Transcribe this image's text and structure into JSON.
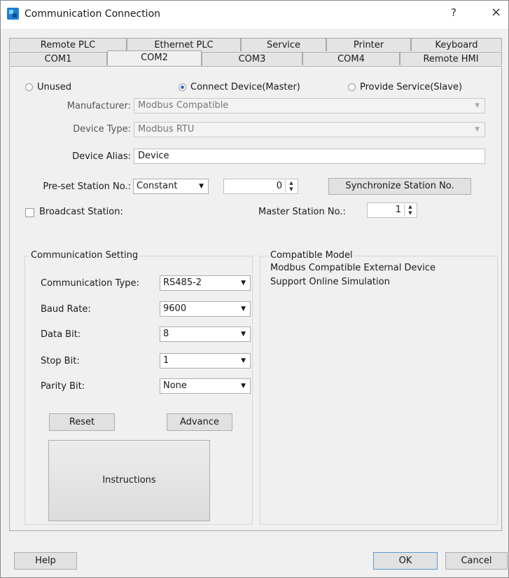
{
  "window": {
    "title": "Communication Connection",
    "help_glyph": "?",
    "close_glyph": "×"
  },
  "tabs_top": [
    "Remote PLC",
    "Ethernet PLC",
    "Service",
    "Printer",
    "Keyboard"
  ],
  "tabs_bottom": [
    "COM1",
    "COM2",
    "COM3",
    "COM4",
    "Remote HMI"
  ],
  "active_tab": "COM2",
  "mode": {
    "unused": "Unused",
    "master": "Connect Device(Master)",
    "slave": "Provide Service(Slave)",
    "selected": "master"
  },
  "manufacturer": {
    "label": "Manufacturer:",
    "value": "Modbus Compatible"
  },
  "device_type": {
    "label": "Device Type:",
    "value": "Modbus RTU"
  },
  "device_alias": {
    "label": "Device Alias:",
    "value": "Device"
  },
  "preset_station": {
    "label": "Pre-set Station No.:",
    "value": "Constant",
    "number": "0"
  },
  "sync_button": "Synchronize Station No.",
  "broadcast": {
    "label": "Broadcast Station:",
    "checked": false
  },
  "master_station": {
    "label": "Master Station No.:",
    "value": "1"
  },
  "comm": {
    "title": "Communication Setting",
    "type": {
      "label": "Communication Type:",
      "value": "RS485-2"
    },
    "baud": {
      "label": "Baud Rate:",
      "value": "9600"
    },
    "data_bit": {
      "label": "Data Bit:",
      "value": "8"
    },
    "stop_bit": {
      "label": "Stop Bit:",
      "value": "1"
    },
    "parity": {
      "label": "Parity Bit:",
      "value": "None"
    },
    "reset": "Reset",
    "advance": "Advance",
    "instructions": "Instructions"
  },
  "compat": {
    "title": "Compatible Model",
    "line1": "Modbus Compatible External Device",
    "line2": "Support Online Simulation"
  },
  "footer": {
    "help": "Help",
    "ok": "OK",
    "cancel": "Cancel"
  },
  "icons": {
    "dropdown": "▼",
    "spin_up": "▲",
    "spin_down": "▼"
  }
}
